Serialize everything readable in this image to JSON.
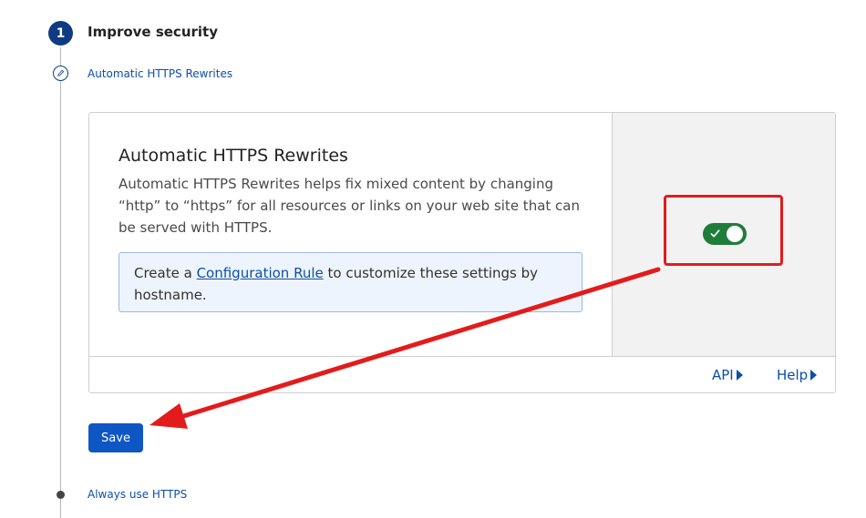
{
  "step": {
    "number": "1",
    "title": "Improve security"
  },
  "substeps": {
    "current_label": "Automatic HTTPS Rewrites",
    "next_label": "Always use HTTPS"
  },
  "setting": {
    "title": "Automatic HTTPS Rewrites",
    "description": "Automatic HTTPS Rewrites helps fix mixed content by changing “http” to “https” for all resources or links on your web site that can be served with HTTPS.",
    "info_prefix": "Create a ",
    "info_link": "Configuration Rule",
    "info_suffix": " to customize these settings by hostname.",
    "toggle_on": true
  },
  "footer": {
    "api_label": "API",
    "help_label": "Help"
  },
  "actions": {
    "save_label": "Save"
  },
  "colors": {
    "accent": "#0e3b82",
    "button": "#0e56c4",
    "toggle_on": "#1e7d3b",
    "annotation": "#e41b1b"
  },
  "icons": {
    "substep_icon": "pencil-icon",
    "toggle_icon": "check-icon",
    "link_icon": "caret-right-icon"
  }
}
